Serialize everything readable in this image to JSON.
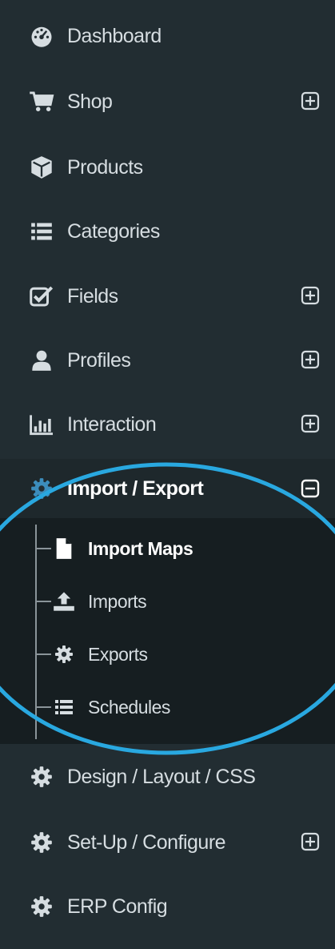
{
  "colors": {
    "sidebar_bg": "#222d32",
    "active_bg": "#1e282c",
    "submenu_bg": "#161e21",
    "text": "#d6dde1",
    "text_active": "#ffffff",
    "annotation": "#29a8e0"
  },
  "menu": {
    "items": [
      {
        "label": "Dashboard",
        "icon": "dashboard-icon",
        "toggle": null
      },
      {
        "label": "Shop",
        "icon": "shopping-cart-icon",
        "toggle": "expand"
      },
      {
        "label": "Products",
        "icon": "cube-icon",
        "toggle": null
      },
      {
        "label": "Categories",
        "icon": "list-icon",
        "toggle": null
      },
      {
        "label": "Fields",
        "icon": "checkbox-icon",
        "toggle": "expand"
      },
      {
        "label": "Profiles",
        "icon": "user-icon",
        "toggle": "expand"
      },
      {
        "label": "Interaction",
        "icon": "bar-chart-icon",
        "toggle": "expand"
      },
      {
        "label": "Import / Export",
        "icon": "gear-icon",
        "toggle": "collapse",
        "active": true
      },
      {
        "label": "Design / Layout / CSS",
        "icon": "gear-icon",
        "toggle": null
      },
      {
        "label": "Set-Up / Configure",
        "icon": "gear-icon",
        "toggle": "expand"
      },
      {
        "label": "ERP Config",
        "icon": "gear-icon",
        "toggle": null
      }
    ],
    "submenu": [
      {
        "label": "Import Maps",
        "icon": "file-icon",
        "current": true
      },
      {
        "label": "Imports",
        "icon": "upload-icon"
      },
      {
        "label": "Exports",
        "icon": "gear-icon"
      },
      {
        "label": "Schedules",
        "icon": "list-icon"
      }
    ]
  }
}
